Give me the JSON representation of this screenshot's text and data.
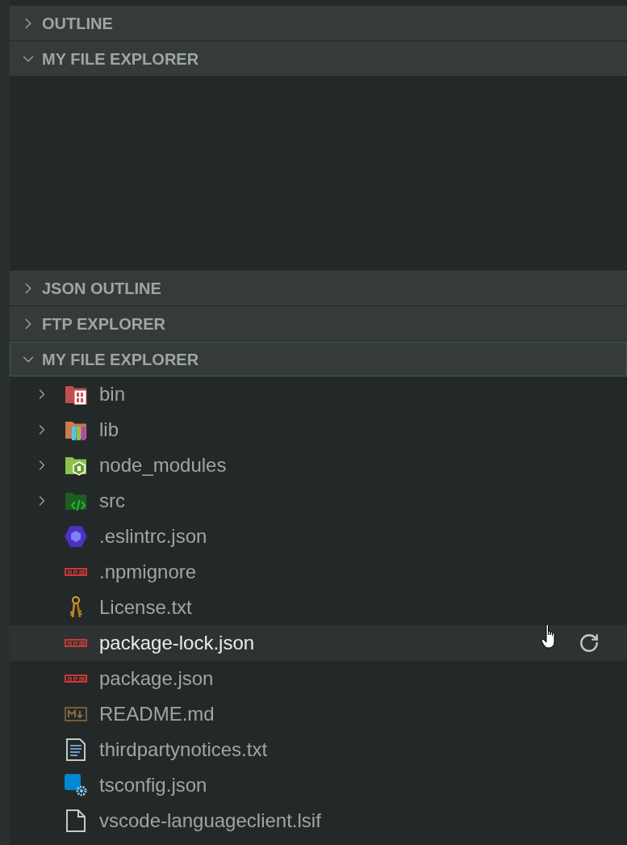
{
  "sections": [
    {
      "title": "OUTLINE",
      "expanded": false,
      "focused": false
    },
    {
      "title": "MY FILE EXPLORER",
      "expanded": true,
      "focused": false
    },
    {
      "title": "JSON OUTLINE",
      "expanded": false,
      "focused": false
    },
    {
      "title": "FTP EXPLORER",
      "expanded": false,
      "focused": false
    },
    {
      "title": "MY FILE EXPLORER",
      "expanded": true,
      "focused": true,
      "items": [
        {
          "name": "bin",
          "kind": "binfolder",
          "hovered": false
        },
        {
          "name": "lib",
          "kind": "libfolder",
          "hovered": false
        },
        {
          "name": "node_modules",
          "kind": "nodefolder",
          "hovered": false
        },
        {
          "name": "src",
          "kind": "srcfolder",
          "hovered": false
        },
        {
          "name": ".eslintrc.json",
          "kind": "eslint",
          "hovered": false
        },
        {
          "name": ".npmignore",
          "kind": "npm",
          "hovered": false
        },
        {
          "name": "License.txt",
          "kind": "license",
          "hovered": false
        },
        {
          "name": "package-lock.json",
          "kind": "npm",
          "hovered": true
        },
        {
          "name": "package.json",
          "kind": "npm",
          "hovered": false
        },
        {
          "name": "README.md",
          "kind": "markdown",
          "hovered": false
        },
        {
          "name": "thirdpartynotices.txt",
          "kind": "text",
          "hovered": false
        },
        {
          "name": "tsconfig.json",
          "kind": "typescript",
          "hovered": false
        },
        {
          "name": "vscode-languageclient.lsif",
          "kind": "plain",
          "hovered": false
        }
      ]
    }
  ]
}
